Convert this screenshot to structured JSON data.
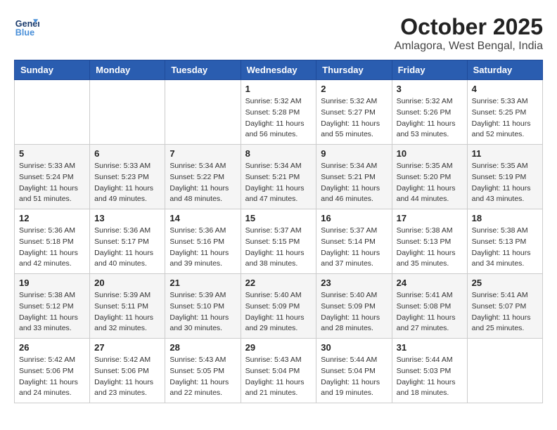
{
  "header": {
    "logo_line1": "General",
    "logo_line2": "Blue",
    "month": "October 2025",
    "location": "Amlagora, West Bengal, India"
  },
  "weekdays": [
    "Sunday",
    "Monday",
    "Tuesday",
    "Wednesday",
    "Thursday",
    "Friday",
    "Saturday"
  ],
  "weeks": [
    [
      {
        "day": "",
        "sunrise": "",
        "sunset": "",
        "daylight": ""
      },
      {
        "day": "",
        "sunrise": "",
        "sunset": "",
        "daylight": ""
      },
      {
        "day": "",
        "sunrise": "",
        "sunset": "",
        "daylight": ""
      },
      {
        "day": "1",
        "sunrise": "Sunrise: 5:32 AM",
        "sunset": "Sunset: 5:28 PM",
        "daylight": "Daylight: 11 hours and 56 minutes."
      },
      {
        "day": "2",
        "sunrise": "Sunrise: 5:32 AM",
        "sunset": "Sunset: 5:27 PM",
        "daylight": "Daylight: 11 hours and 55 minutes."
      },
      {
        "day": "3",
        "sunrise": "Sunrise: 5:32 AM",
        "sunset": "Sunset: 5:26 PM",
        "daylight": "Daylight: 11 hours and 53 minutes."
      },
      {
        "day": "4",
        "sunrise": "Sunrise: 5:33 AM",
        "sunset": "Sunset: 5:25 PM",
        "daylight": "Daylight: 11 hours and 52 minutes."
      }
    ],
    [
      {
        "day": "5",
        "sunrise": "Sunrise: 5:33 AM",
        "sunset": "Sunset: 5:24 PM",
        "daylight": "Daylight: 11 hours and 51 minutes."
      },
      {
        "day": "6",
        "sunrise": "Sunrise: 5:33 AM",
        "sunset": "Sunset: 5:23 PM",
        "daylight": "Daylight: 11 hours and 49 minutes."
      },
      {
        "day": "7",
        "sunrise": "Sunrise: 5:34 AM",
        "sunset": "Sunset: 5:22 PM",
        "daylight": "Daylight: 11 hours and 48 minutes."
      },
      {
        "day": "8",
        "sunrise": "Sunrise: 5:34 AM",
        "sunset": "Sunset: 5:21 PM",
        "daylight": "Daylight: 11 hours and 47 minutes."
      },
      {
        "day": "9",
        "sunrise": "Sunrise: 5:34 AM",
        "sunset": "Sunset: 5:21 PM",
        "daylight": "Daylight: 11 hours and 46 minutes."
      },
      {
        "day": "10",
        "sunrise": "Sunrise: 5:35 AM",
        "sunset": "Sunset: 5:20 PM",
        "daylight": "Daylight: 11 hours and 44 minutes."
      },
      {
        "day": "11",
        "sunrise": "Sunrise: 5:35 AM",
        "sunset": "Sunset: 5:19 PM",
        "daylight": "Daylight: 11 hours and 43 minutes."
      }
    ],
    [
      {
        "day": "12",
        "sunrise": "Sunrise: 5:36 AM",
        "sunset": "Sunset: 5:18 PM",
        "daylight": "Daylight: 11 hours and 42 minutes."
      },
      {
        "day": "13",
        "sunrise": "Sunrise: 5:36 AM",
        "sunset": "Sunset: 5:17 PM",
        "daylight": "Daylight: 11 hours and 40 minutes."
      },
      {
        "day": "14",
        "sunrise": "Sunrise: 5:36 AM",
        "sunset": "Sunset: 5:16 PM",
        "daylight": "Daylight: 11 hours and 39 minutes."
      },
      {
        "day": "15",
        "sunrise": "Sunrise: 5:37 AM",
        "sunset": "Sunset: 5:15 PM",
        "daylight": "Daylight: 11 hours and 38 minutes."
      },
      {
        "day": "16",
        "sunrise": "Sunrise: 5:37 AM",
        "sunset": "Sunset: 5:14 PM",
        "daylight": "Daylight: 11 hours and 37 minutes."
      },
      {
        "day": "17",
        "sunrise": "Sunrise: 5:38 AM",
        "sunset": "Sunset: 5:13 PM",
        "daylight": "Daylight: 11 hours and 35 minutes."
      },
      {
        "day": "18",
        "sunrise": "Sunrise: 5:38 AM",
        "sunset": "Sunset: 5:13 PM",
        "daylight": "Daylight: 11 hours and 34 minutes."
      }
    ],
    [
      {
        "day": "19",
        "sunrise": "Sunrise: 5:38 AM",
        "sunset": "Sunset: 5:12 PM",
        "daylight": "Daylight: 11 hours and 33 minutes."
      },
      {
        "day": "20",
        "sunrise": "Sunrise: 5:39 AM",
        "sunset": "Sunset: 5:11 PM",
        "daylight": "Daylight: 11 hours and 32 minutes."
      },
      {
        "day": "21",
        "sunrise": "Sunrise: 5:39 AM",
        "sunset": "Sunset: 5:10 PM",
        "daylight": "Daylight: 11 hours and 30 minutes."
      },
      {
        "day": "22",
        "sunrise": "Sunrise: 5:40 AM",
        "sunset": "Sunset: 5:09 PM",
        "daylight": "Daylight: 11 hours and 29 minutes."
      },
      {
        "day": "23",
        "sunrise": "Sunrise: 5:40 AM",
        "sunset": "Sunset: 5:09 PM",
        "daylight": "Daylight: 11 hours and 28 minutes."
      },
      {
        "day": "24",
        "sunrise": "Sunrise: 5:41 AM",
        "sunset": "Sunset: 5:08 PM",
        "daylight": "Daylight: 11 hours and 27 minutes."
      },
      {
        "day": "25",
        "sunrise": "Sunrise: 5:41 AM",
        "sunset": "Sunset: 5:07 PM",
        "daylight": "Daylight: 11 hours and 25 minutes."
      }
    ],
    [
      {
        "day": "26",
        "sunrise": "Sunrise: 5:42 AM",
        "sunset": "Sunset: 5:06 PM",
        "daylight": "Daylight: 11 hours and 24 minutes."
      },
      {
        "day": "27",
        "sunrise": "Sunrise: 5:42 AM",
        "sunset": "Sunset: 5:06 PM",
        "daylight": "Daylight: 11 hours and 23 minutes."
      },
      {
        "day": "28",
        "sunrise": "Sunrise: 5:43 AM",
        "sunset": "Sunset: 5:05 PM",
        "daylight": "Daylight: 11 hours and 22 minutes."
      },
      {
        "day": "29",
        "sunrise": "Sunrise: 5:43 AM",
        "sunset": "Sunset: 5:04 PM",
        "daylight": "Daylight: 11 hours and 21 minutes."
      },
      {
        "day": "30",
        "sunrise": "Sunrise: 5:44 AM",
        "sunset": "Sunset: 5:04 PM",
        "daylight": "Daylight: 11 hours and 19 minutes."
      },
      {
        "day": "31",
        "sunrise": "Sunrise: 5:44 AM",
        "sunset": "Sunset: 5:03 PM",
        "daylight": "Daylight: 11 hours and 18 minutes."
      },
      {
        "day": "",
        "sunrise": "",
        "sunset": "",
        "daylight": ""
      }
    ]
  ]
}
